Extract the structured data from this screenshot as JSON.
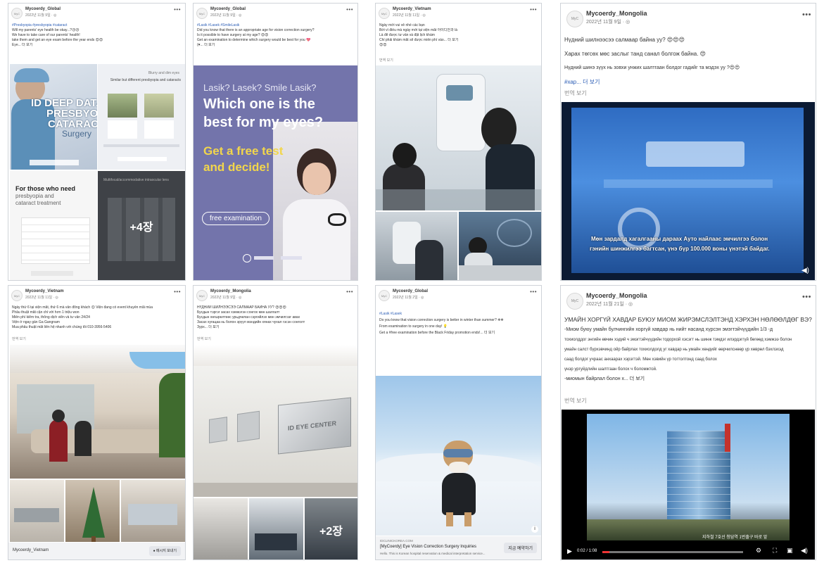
{
  "cards": [
    {
      "page": "Mycoerdy_Global",
      "date": "2022년 11월 9일 · ◎",
      "lines": [
        "#Presbyopia #presbyopia #cataract",
        "Will my parents' eye health be okay...?😥😥",
        "We have to take care of our parents' health!",
        "take them and get an eye exam before the year ends 😍😍",
        "Eye... 더 보기"
      ],
      "img_left": {
        "big1": "ID DEEP DATA",
        "big2": "PRESBYOPIA",
        "big3": "CATARACT",
        "small": "Surgery"
      },
      "img_right": {
        "title": "Blurry and dim eyes",
        "sub": "Similar but different presbyopia and cataracts"
      },
      "img_bottom_left": {
        "t1": "For those who need",
        "t2": "presbyopia and",
        "t3": "cataract treatment"
      },
      "img_bottom_right": {
        "title": "Multifocal/accommodative intraocular lens",
        "count": "+4장"
      }
    },
    {
      "page": "Mycoerdy_Global",
      "date": "2022년 11월 9일 · ◎",
      "lines": [
        "#Lasik #Lasek #SmileLasik",
        "Did you know that there is an appropriate age for vision correction surgery?",
        "Is it possible to have surgery at my age? 😍😍",
        "Get an examination to determine which surgery would be best for you 💖",
        "(♥... 더 보기"
      ],
      "ad": {
        "q1": "Lasik? Lasek? Smile Lasik?",
        "h1": "Which one is the",
        "h2": "best for my eyes?",
        "y1": "Get a free test",
        "y2": "and decide!",
        "badge": "free examination"
      }
    },
    {
      "page": "Mycoerdy_Vietnam",
      "date": "2022년 11월 11일 · ◎",
      "lines": [
        "Ngày mới vui vẻ nhé các bạn",
        "Bởi vì điều mà ngày mới tại viện mắt 아이디안과 là",
        "Là để được tư vấn và đặt lịch khám",
        "Chỉ phải khám mắt sẽ được miễn phí vào... 더 보기",
        "😍😍"
      ],
      "translate": "번역 보기"
    },
    {
      "page": "Mycoerdy_Mongolia",
      "date": "2022년 11월 9일 · ◎",
      "lines": [
        "Нүдний шилнээсээ салмаар байна уу? 😍😍😍",
        "Харах төгсөх мөс заслыг танд санал болгож байна. 😍",
        "Нүдний шинэ зүүх нь зовхи унжих шалтгаан болдог гадийг та мэдэх уу ?😍😍",
        "#хар... 더 보기"
      ],
      "translate": "번역 보기",
      "caption1": "Мөн зардалд хагалгааны дараах Ауто найлаас эмчилгээ болон",
      "caption2": "гэнийн шинжилгээ багтсан, үнэ бүр 100.000 воны үнэтэй байдаг."
    },
    {
      "page": "Mycoerdy_Vietnam",
      "date": "2022년 11월 11일 · ◎",
      "lines": [
        "Ngày thứ 6 tại viện mắt, thứ 6 mà vẫn đông khách 😊 Viện đang có event khuyến mãi mùa",
        "Phẫu thuật mắt cận chỉ với hơn 1 triệu won",
        "Miễn phí kiểm tra, thông dịch viên và tư vấn 24/24",
        "Viện ở ngay gần Ga Gangnam",
        "Mua phẫu thuật mắt liên hệ nhanh với chúng tôi 010-3956-5406"
      ],
      "translate": "번역 보기",
      "footer_name": "Mycoerdy_Vietnam",
      "footer_btn": "메시지 보내기"
    },
    {
      "page": "Mycoerdy_Mongolia",
      "date": "2022년 11월 9일 · ◎",
      "lines": [
        "НҮДНИЙ ШИЛНЭЭСЭЭ САЛМААР БАЙНА УУ? 😍😍😍",
        "Бусдын тэргэг засах хэмжэгэн сонгох мөн шалгалт",
        "Бусдын хөгшрөлтөөс урьдчилан сэргийлэх мөн эмчилгээг авах ",
        "Засах хугацаа нь болон эрүүл мэндийн хянах чухал гэсэн сонголт ",
        "Зурх... 더 보기"
      ],
      "translate": "번역 보기",
      "sign": "ID EYE CENTER",
      "count": "+2장"
    },
    {
      "page": "Mycoerdy_Global",
      "date": "2022년 11월 2일 · ◎",
      "lines": [
        "#Lasik #Lasek",
        "Do you know that vision correction surgery is better in winter than summer? ❄❄",
        "From examination to surgery in one day! 💡",
        "Get a #free examination before the Black Friday promotion ends!... 더 보기"
      ],
      "ad_site": "IDCLINICKOREA.COM",
      "ad_title": "[MyCoerdy] Eye Vision Correction Surgery Inquiries",
      "ad_desc": "Hello. This is Korean hospital reservation & medical interpretation service...",
      "ad_btn": "지금 예약하기"
    },
    {
      "page": "Mycoerdy_Mongolia",
      "date": "2022년 11월 21일 · ◎",
      "headline": "УМАЙН ХОРГҮЙ ХАВДАР БУЮУ МИОМ ЖИРЭМСЛЭЛТЭНД ХЭРХЭН НӨЛӨӨЛДӨГ ВЭ?",
      "lines": [
        "-Миом буюу умайн булчингийн хоргүй хавдар нь нийт насанд хүрсэн эмэгтэйчүүдийн 1/3 -д",
        "тохиолддог энгийн өвчин хэдий ч эмэгтэйчүүдийн тодорхой хэсэгт нь шинж тэмдэг илэрдэггүй бөгөөд хэмжээ болон",
        "умайн салст бүрхэвчинд ойр байрлах тохиолдолд уг хавдар нь умайн хөндийг өөрчилснөөр үр хөврөл бэхлэхэд",
        "саад болдог учраас анхаарах хэрэгтэй. Мөн хэвийн үр тогтолтонд саад болох",
        "үнэр ургуйдлийн шалтгаан болох ч боломжтой."
      ],
      "more_line": "-миомын байрлал болон х... 더 보기",
      "translate": "번역 보기",
      "video_time": "0:02 / 1:08",
      "video_caption": "지하철 7호선 청담역 1번출구 바로 앞"
    }
  ],
  "colors": {
    "link": "#2b5db5",
    "ad_purple": "#6e6fa8",
    "ad_yellow": "#f2d64b"
  },
  "icons": [
    "more-icon",
    "globe-icon",
    "play-icon",
    "volume-icon",
    "gear-icon",
    "fullscreen-icon",
    "message-icon"
  ]
}
